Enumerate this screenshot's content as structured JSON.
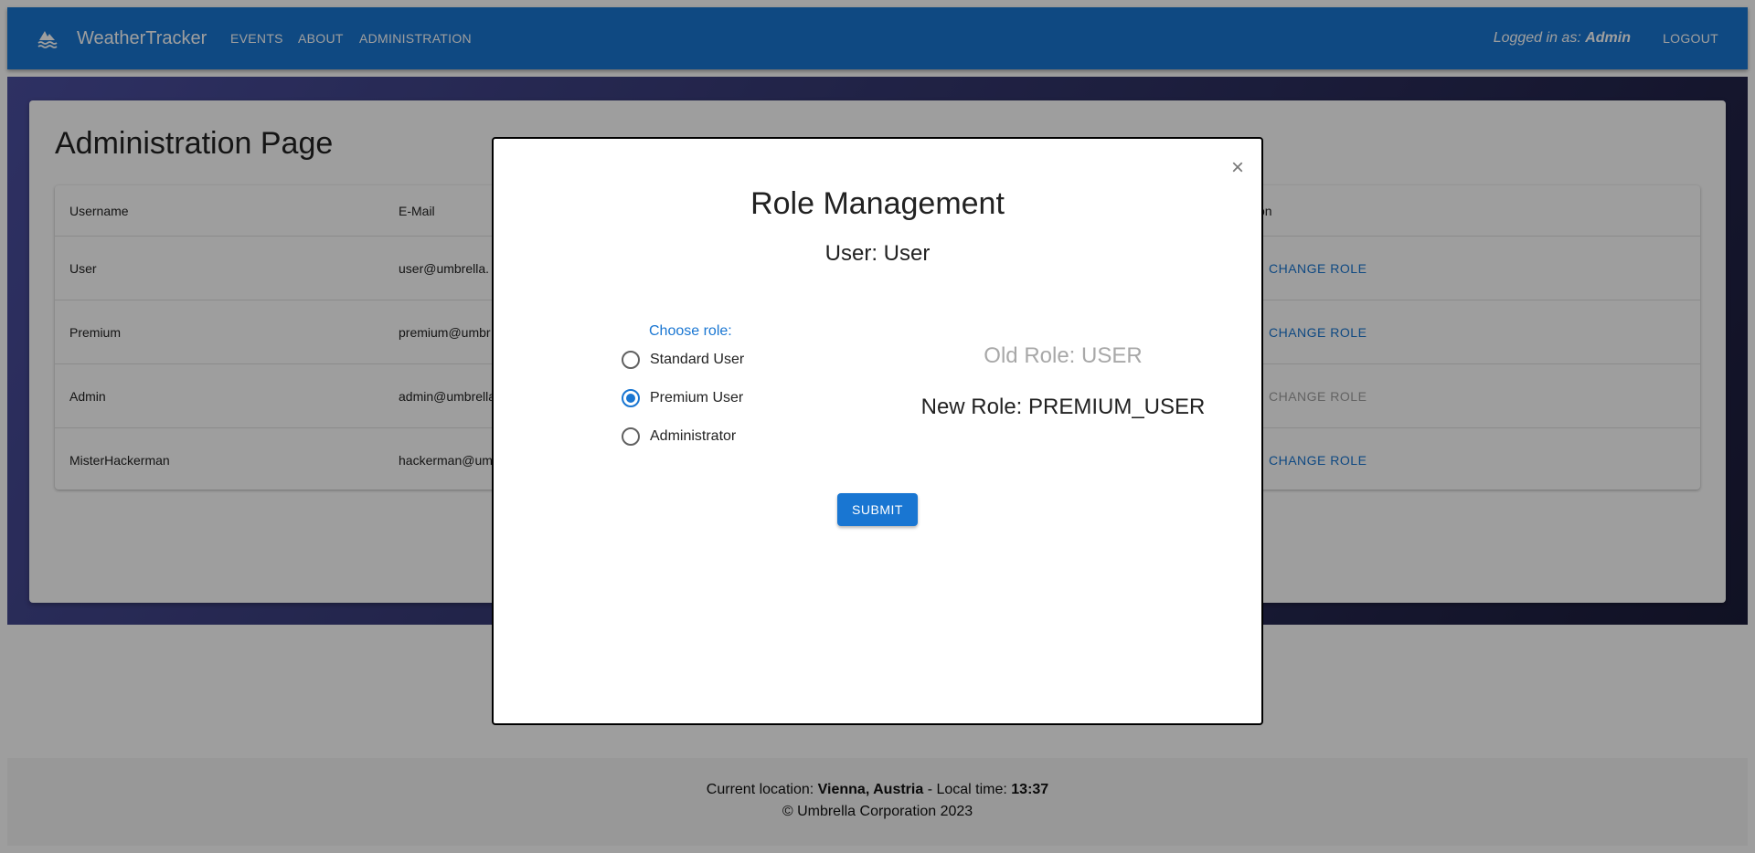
{
  "navbar": {
    "brand": "WeatherTracker",
    "links": [
      "EVENTS",
      "ABOUT",
      "ADMINISTRATION"
    ],
    "logged_in_prefix": "Logged in as:",
    "logged_in_user": "Admin",
    "logout": "LOGOUT",
    "color": "#1976d2"
  },
  "admin": {
    "title": "Administration Page",
    "columns": {
      "username": "Username",
      "email": "E-Mail",
      "action": "on"
    },
    "rows": [
      {
        "username": "User",
        "email": "user@umbrella.",
        "action": "CHANGE ROLE"
      },
      {
        "username": "Premium",
        "email": "premium@umbr",
        "action": "CHANGE ROLE"
      },
      {
        "username": "Admin",
        "email": "admin@umbrella",
        "action": "CHANGE ROLE"
      },
      {
        "username": "MisterHackerman",
        "email": "hackerman@um",
        "action": "CHANGE ROLE"
      }
    ]
  },
  "modal": {
    "title": "Role Management",
    "subtitle": "User: User",
    "legend": "Choose role:",
    "options": [
      "Standard User",
      "Premium User",
      "Administrator"
    ],
    "selected": "Premium User",
    "old_role": "Old Role: USER",
    "new_role": "New Role: PREMIUM_USER",
    "submit": "SUBMIT",
    "close": "×"
  },
  "footer": {
    "location_prefix": "Current location:",
    "location": "Vienna, Austria",
    "time_prefix": "- Local time:",
    "time": "13:37",
    "copyright": "© Umbrella Corporation 2023"
  }
}
